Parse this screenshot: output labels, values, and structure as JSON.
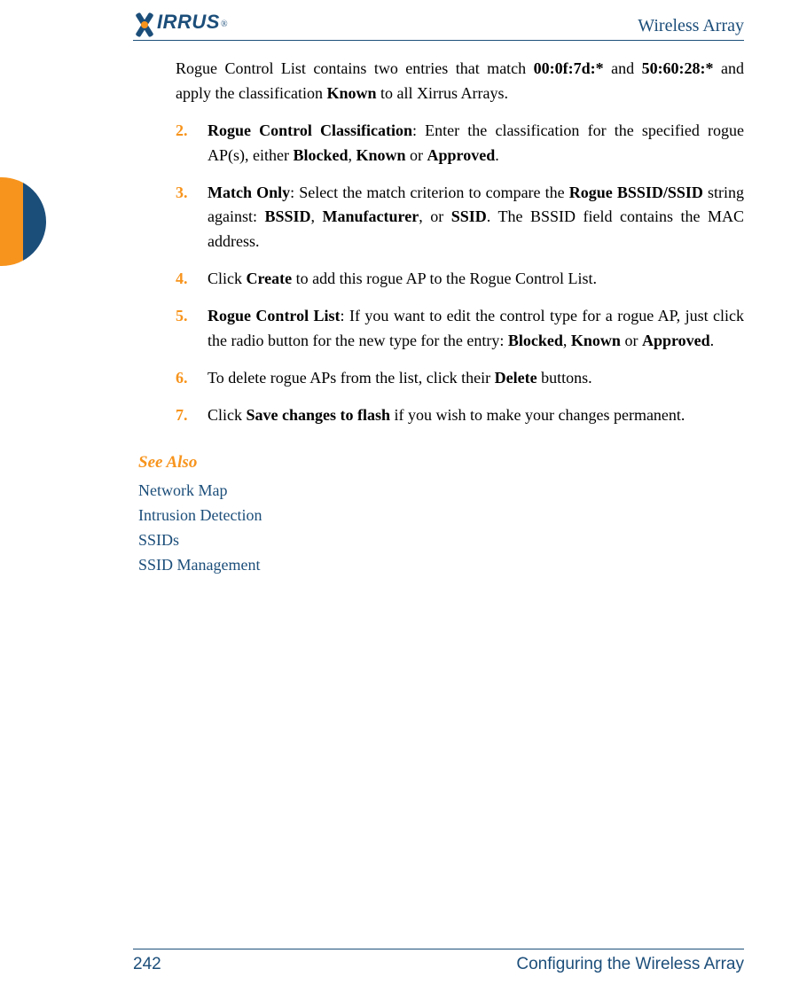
{
  "header": {
    "logo_text": "IRRUS",
    "logo_reg": "®",
    "doc_title": "Wireless Array"
  },
  "lead": {
    "p1a": "Rogue Control List contains two entries that match ",
    "mac1": "00:0f:7d:*",
    "p1b": " and ",
    "mac2": "50:60:28:*",
    "p1c": " and apply the classification ",
    "known": "Known",
    "p1d": " to all Xirrus Arrays."
  },
  "steps": [
    {
      "num": "2.",
      "parts": [
        {
          "t": "Rogue Control Classification",
          "b": true
        },
        {
          "t": ": Enter the classification for the specified rogue AP(s), either "
        },
        {
          "t": "Blocked",
          "b": true
        },
        {
          "t": ", "
        },
        {
          "t": "Known",
          "b": true
        },
        {
          "t": " or "
        },
        {
          "t": "Approved",
          "b": true
        },
        {
          "t": "."
        }
      ]
    },
    {
      "num": "3.",
      "parts": [
        {
          "t": "Match Only",
          "b": true
        },
        {
          "t": ": Select the match criterion to compare the "
        },
        {
          "t": "Rogue BSSID/SSID",
          "b": true
        },
        {
          "t": " string against: "
        },
        {
          "t": "BSSID",
          "b": true
        },
        {
          "t": ", "
        },
        {
          "t": "Manufacturer",
          "b": true
        },
        {
          "t": ", or "
        },
        {
          "t": "SSID",
          "b": true
        },
        {
          "t": ". The BSSID field contains the MAC address."
        }
      ]
    },
    {
      "num": "4.",
      "parts": [
        {
          "t": "Click "
        },
        {
          "t": "Create",
          "b": true
        },
        {
          "t": " to add this rogue AP to the Rogue Control List."
        }
      ]
    },
    {
      "num": "5.",
      "parts": [
        {
          "t": "Rogue Control List",
          "b": true
        },
        {
          "t": ": If you want to edit the control type for a rogue AP, just click the radio button for the new type for the entry: "
        },
        {
          "t": "Blocked",
          "b": true
        },
        {
          "t": ", "
        },
        {
          "t": "Known",
          "b": true
        },
        {
          "t": " or "
        },
        {
          "t": "Approved",
          "b": true
        },
        {
          "t": "."
        }
      ]
    },
    {
      "num": "6.",
      "parts": [
        {
          "t": "To delete rogue APs from the list, click their "
        },
        {
          "t": "Delete",
          "b": true
        },
        {
          "t": " buttons."
        }
      ]
    },
    {
      "num": "7.",
      "parts": [
        {
          "t": "Click "
        },
        {
          "t": "Save changes to flash",
          "b": true
        },
        {
          "t": " if you wish to make your changes permanent."
        }
      ]
    }
  ],
  "see_also": {
    "heading": "See Also",
    "links": [
      "Network Map",
      "Intrusion Detection",
      "SSIDs",
      "SSID Management"
    ]
  },
  "footer": {
    "page": "242",
    "section": "Configuring the Wireless Array"
  }
}
